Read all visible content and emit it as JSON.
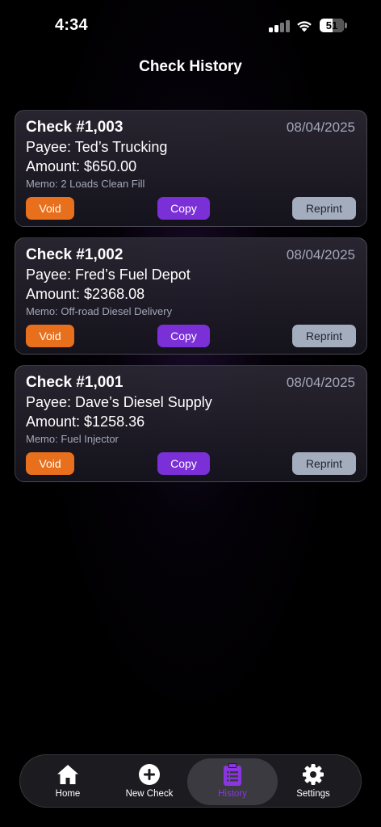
{
  "status_bar": {
    "time": "4:34",
    "battery": "51",
    "icons": [
      "signal-icon",
      "wifi-icon",
      "battery-icon"
    ]
  },
  "header": {
    "title": "Check History"
  },
  "colors": {
    "void": "#e86f1c",
    "copy": "#7b2fd6",
    "reprint": "#a4adbe",
    "active_tab": "#8a36e0"
  },
  "checks": [
    {
      "number": "Check #1,003",
      "date": "08/04/2025",
      "payee": "Payee: Ted’s Trucking",
      "amount": "Amount: $650.00",
      "memo": "Memo: 2 Loads Clean Fill",
      "void_label": "Void",
      "copy_label": "Copy",
      "reprint_label": "Reprint"
    },
    {
      "number": "Check #1,002",
      "date": "08/04/2025",
      "payee": "Payee: Fred’s Fuel Depot",
      "amount": "Amount: $2368.08",
      "memo": "Memo: Off-road Diesel Delivery",
      "void_label": "Void",
      "copy_label": "Copy",
      "reprint_label": "Reprint"
    },
    {
      "number": "Check #1,001",
      "date": "08/04/2025",
      "payee": "Payee: Dave’s Diesel Supply",
      "amount": "Amount: $1258.36",
      "memo": "Memo: Fuel Injector",
      "void_label": "Void",
      "copy_label": "Copy",
      "reprint_label": "Reprint"
    }
  ],
  "tabs": [
    {
      "label": "Home",
      "icon": "home-icon",
      "active": false
    },
    {
      "label": "New Check",
      "icon": "plus-circle-icon",
      "active": false
    },
    {
      "label": "History",
      "icon": "clipboard-list-icon",
      "active": true
    },
    {
      "label": "Settings",
      "icon": "gear-icon",
      "active": false
    }
  ]
}
